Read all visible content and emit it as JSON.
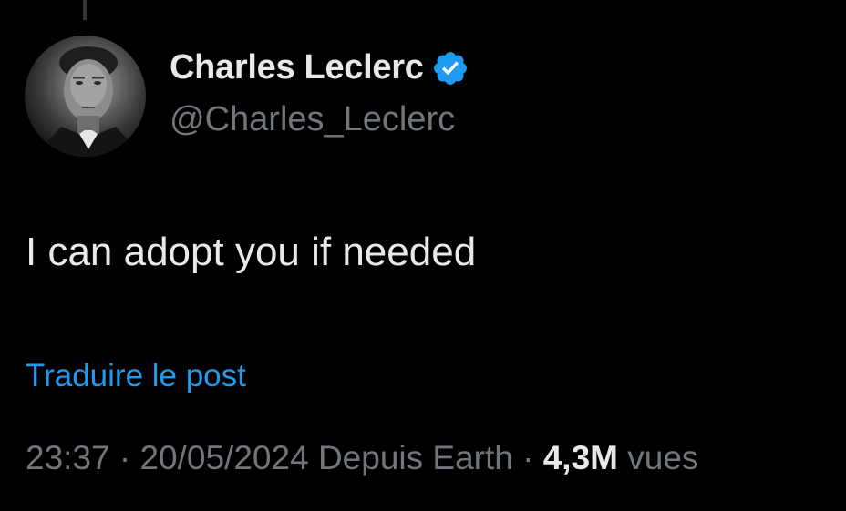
{
  "tweet": {
    "author": {
      "name": "Charles Leclerc",
      "handle": "@Charles_Leclerc",
      "verified_icon": "verified-badge-icon",
      "verified_color": "#1d9bf0"
    },
    "text": "I can adopt you if needed",
    "translate_label": "Traduire le post",
    "meta": {
      "time": "23:37",
      "separator": "·",
      "date": "20/05/2024",
      "source": "Depuis Earth",
      "views_count": "4,3M",
      "views_label": "vues"
    }
  },
  "colors": {
    "background": "#000000",
    "primary_text": "#e7e9ea",
    "secondary_text": "#71767b",
    "link": "#1d9bf0"
  }
}
